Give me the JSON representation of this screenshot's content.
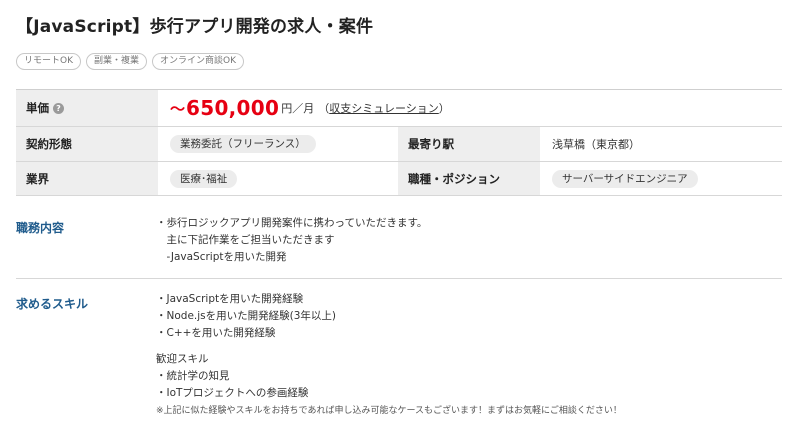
{
  "title": "【JavaScript】歩行アプリ開発の求人・案件",
  "tags": [
    "リモートOK",
    "副業・複業",
    "オンライン商談OK"
  ],
  "spec": {
    "price_label": "単価",
    "price_help_icon": "?",
    "price_prefix": "～",
    "price_value": "650,000",
    "price_unit": "円／月",
    "price_link_open": "（",
    "price_link": "収支シミュレーション",
    "price_link_close": "）",
    "contract_label": "契約形態",
    "contract_value": "業務委託（フリーランス）",
    "station_label": "最寄り駅",
    "station_value": "浅草橋（東京都）",
    "industry_label": "業界",
    "industry_value": "医療･福祉",
    "position_label": "職種・ポジション",
    "position_value": "サーバーサイドエンジニア"
  },
  "duties": {
    "label": "職務内容",
    "lines": [
      "・歩行ロジックアプリ開発案件に携わっていただきます。",
      "　主に下記作業をご担当いただきます",
      "　-JavaScriptを用いた開発"
    ]
  },
  "skills": {
    "label": "求めるスキル",
    "required": [
      "・JavaScriptを用いた開発経験",
      "・Node.jsを用いた開発経験(3年以上)",
      "・C++を用いた開発経験"
    ],
    "welcome_title": "歓迎スキル",
    "welcome": [
      "・統計学の知見",
      "・IoTプロジェクトへの参画経験"
    ],
    "note": "※上記に似た経験やスキルをお持ちであれば申し込み可能なケースもございます！まずはお気軽にご相談ください！"
  }
}
